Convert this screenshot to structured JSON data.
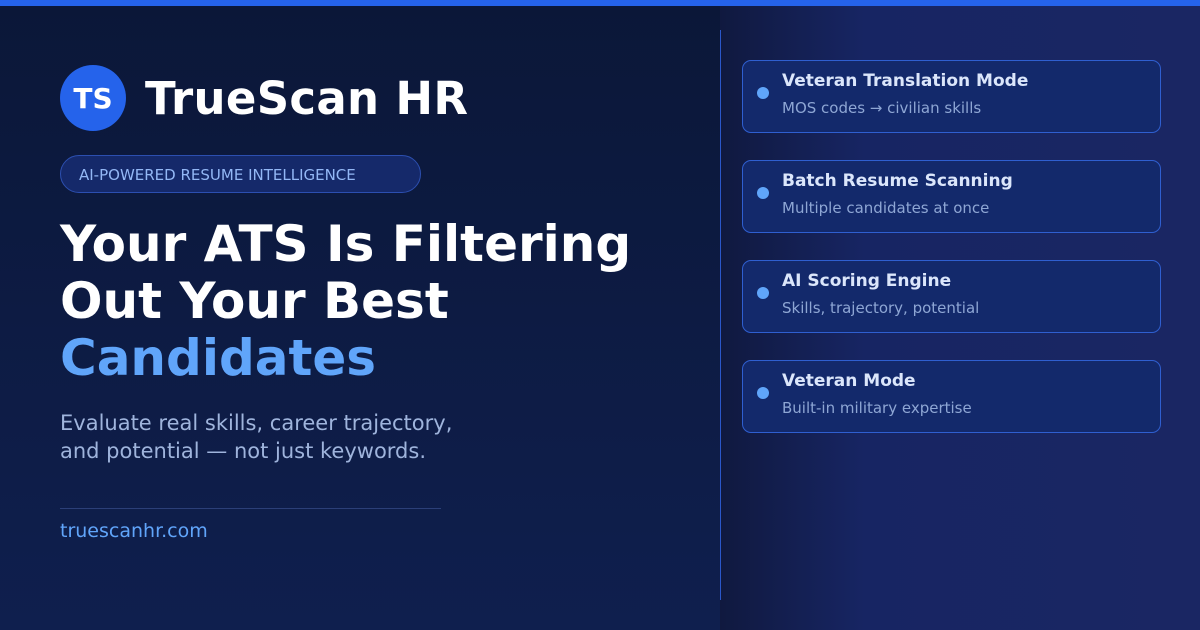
{
  "brand": {
    "logo_initials": "TS",
    "name": "TrueScan HR"
  },
  "tagline": "AI-POWERED RESUME INTELLIGENCE",
  "headline": {
    "line1": "Your ATS Is Filtering",
    "line2": "Out Your Best",
    "line3_accent": "Candidates"
  },
  "subtext": {
    "line1": "Evaluate real skills, career trajectory,",
    "line2": "and potential — not just keywords."
  },
  "website": "truescanhr.com",
  "features": [
    {
      "title": "Veteran Translation Mode",
      "description": "MOS codes → civilian skills"
    },
    {
      "title": "Batch Resume Scanning",
      "description": "Multiple candidates at once"
    },
    {
      "title": "AI Scoring Engine",
      "description": "Skills, trajectory, potential"
    },
    {
      "title": "Veteran Mode",
      "description": "Built-in military expertise"
    }
  ],
  "colors": {
    "accent": "#2563eb",
    "accent_light": "#60a5fa",
    "background": "#0f1f4e"
  }
}
